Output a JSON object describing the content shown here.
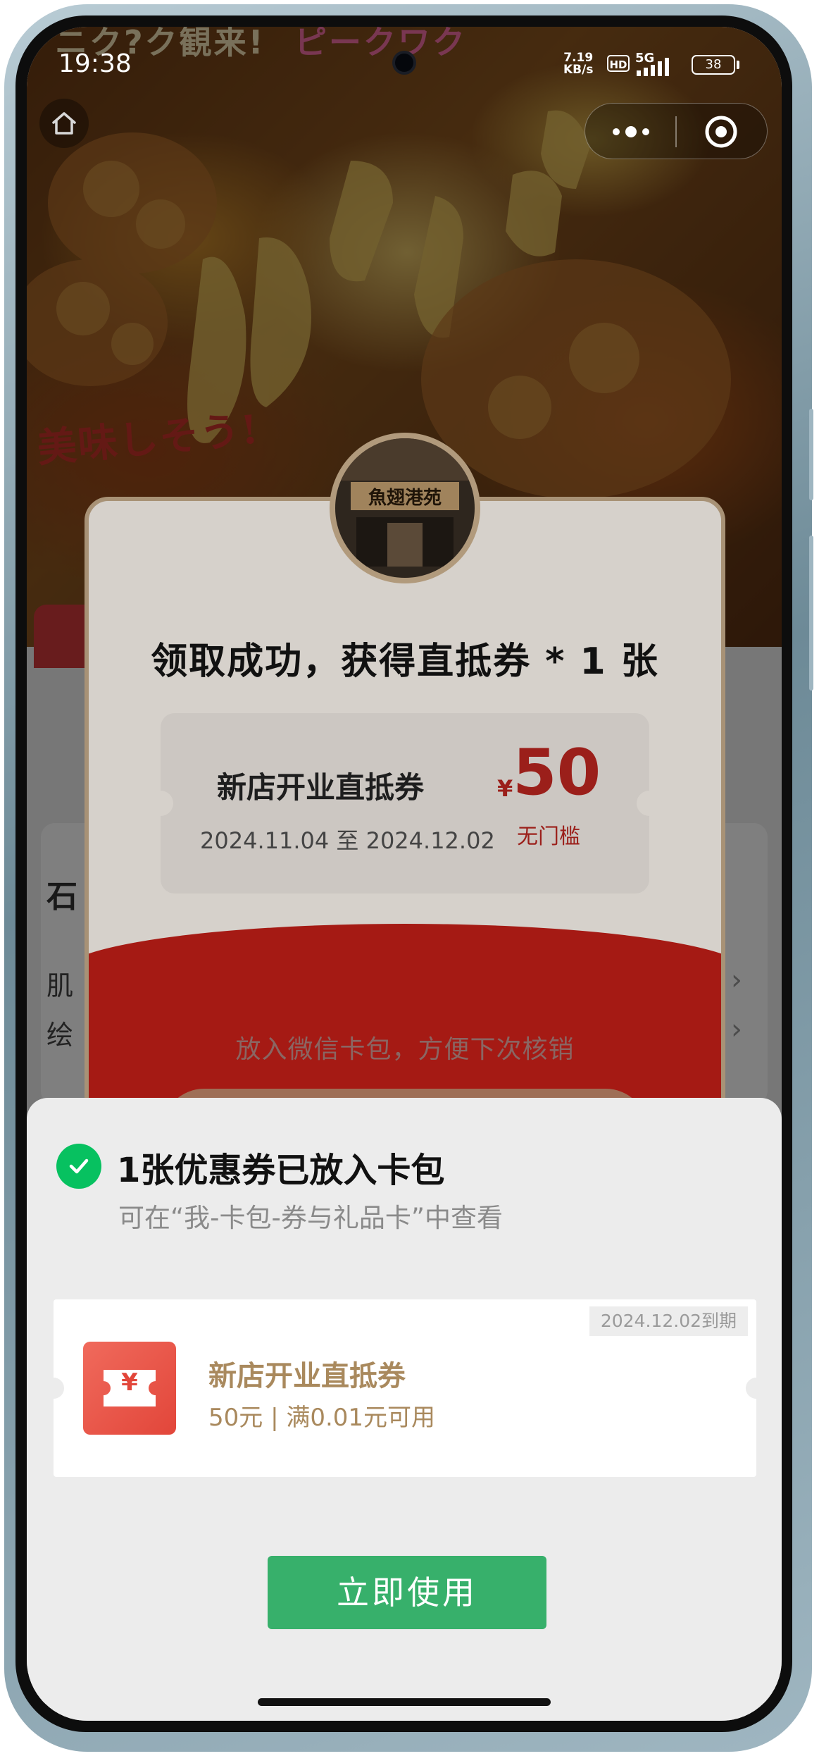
{
  "status_bar": {
    "time": "19:38",
    "net_speed_value": "7.19",
    "net_speed_unit": "KB/s",
    "hd": "HD",
    "network": "5G",
    "battery": "38"
  },
  "background_page": {
    "hero_text_top_left": "ニク?ク観来!",
    "hero_text_top_right": "ピークワク",
    "hero_text_red": "美味しそう!",
    "side_char_1": "石",
    "side_char_2": "肌",
    "side_char_3": "绘"
  },
  "modal": {
    "title": "领取成功，获得直抵券 * 1 张",
    "avatar_sign": "魚翅港苑",
    "coupon": {
      "name": "新店开业直抵券",
      "date_start": "2024.11.04",
      "date_sep": "至",
      "date_end": "2024.12.02",
      "currency": "¥",
      "amount": "50",
      "condition": "无门槛"
    },
    "hint": "放入微信卡包，方便下次核销"
  },
  "sheet": {
    "title": "1张优惠券已放入卡包",
    "subtitle": "可在“我-卡包-券与礼品卡”中查看",
    "card": {
      "expire": "2024.12.02到期",
      "icon_symbol": "¥",
      "name": "新店开业直抵券",
      "desc": "50元 | 满0.01元可用"
    },
    "use_button": "立即使用"
  },
  "icons": {
    "home": "home-icon",
    "more": "more-dots-icon",
    "close": "target-close-icon",
    "check": "check-icon",
    "ticket": "ticket-icon"
  },
  "colors": {
    "wechat_green": "#07c160",
    "use_button": "#37b06b",
    "coupon_red": "#9b1f1a",
    "card_gold": "#a9895d"
  }
}
